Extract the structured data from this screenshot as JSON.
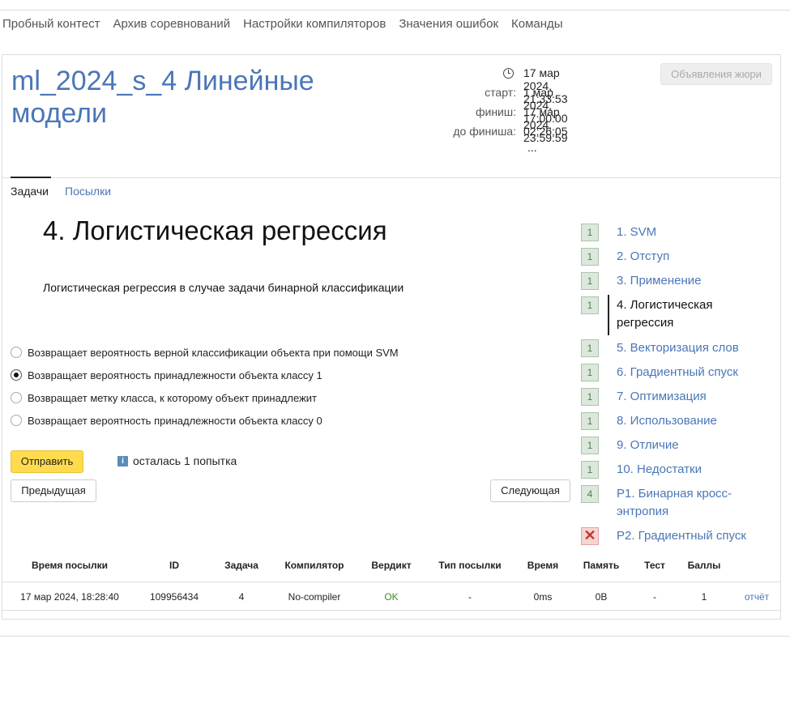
{
  "top_nav": [
    "Пробный контест",
    "Архив соревнований",
    "Настройки компиляторов",
    "Значения ошибок",
    "Команды"
  ],
  "contest": {
    "title": "ml_2024_s_4 Линейные модели",
    "current_time": "17 мар 2024, 21:33:53",
    "start_label": "старт:",
    "start_value": "1 мар 2024, 17:00:00",
    "finish_label": "финиш:",
    "finish_value": "17 мар 2024, 23:59:59",
    "remaining_label": "до финиша:",
    "remaining_value": "02:26:05",
    "ellipsis": "...",
    "announce_button": "Объявления жюри"
  },
  "tabs": {
    "tasks": "Задачи",
    "submits": "Посылки"
  },
  "problem": {
    "title": "4. Логистическая регрессия",
    "description": "Логистическая регрессия в случае задачи бинарной классификации",
    "options": [
      {
        "label": "Возвращает вероятность верной классификации объекта при помощи SVM",
        "checked": false
      },
      {
        "label": "Возвращает вероятность принадлежности объекта классу 1",
        "checked": true
      },
      {
        "label": "Возвращает метку класса, к которому объект принадлежит",
        "checked": false
      },
      {
        "label": "Возвращает вероятность принадлежности объекта классу 0",
        "checked": false
      }
    ],
    "submit_button": "Отправить",
    "attempts_text": "осталась 1 попытка",
    "info_icon": "i",
    "prev_button": "Предыдущая",
    "next_button": "Следующая"
  },
  "problem_list": [
    {
      "badge": "1",
      "label": "1. SVM",
      "status": "ok"
    },
    {
      "badge": "1",
      "label": "2. Отступ",
      "status": "ok"
    },
    {
      "badge": "1",
      "label": "3. Применение",
      "status": "ok"
    },
    {
      "badge": "1",
      "label": "4. Логистическая регрессия",
      "status": "ok",
      "active": true
    },
    {
      "badge": "1",
      "label": "5. Векторизация слов",
      "status": "ok"
    },
    {
      "badge": "1",
      "label": "6. Градиентный спуск",
      "status": "ok"
    },
    {
      "badge": "1",
      "label": "7. Оптимизация",
      "status": "ok"
    },
    {
      "badge": "1",
      "label": "8. Использование",
      "status": "ok"
    },
    {
      "badge": "1",
      "label": "9. Отличие",
      "status": "ok"
    },
    {
      "badge": "1",
      "label": "10. Недостатки",
      "status": "ok"
    },
    {
      "badge": "4",
      "label": "P1. Бинарная кросс-энтропия",
      "status": "ok"
    },
    {
      "badge": "✕",
      "label": "P2. Градиентный спуск",
      "status": "fail"
    }
  ],
  "submissions": {
    "headers": [
      "Время посылки",
      "ID",
      "Задача",
      "Компилятор",
      "Вердикт",
      "Тип посылки",
      "Время",
      "Память",
      "Тест",
      "Баллы"
    ],
    "rows": [
      [
        "17 мар 2024, 18:28:40",
        "109956434",
        "4",
        "No-compiler",
        "OK",
        "-",
        "0ms",
        "0B",
        "-",
        "1",
        "отчёт"
      ]
    ]
  }
}
